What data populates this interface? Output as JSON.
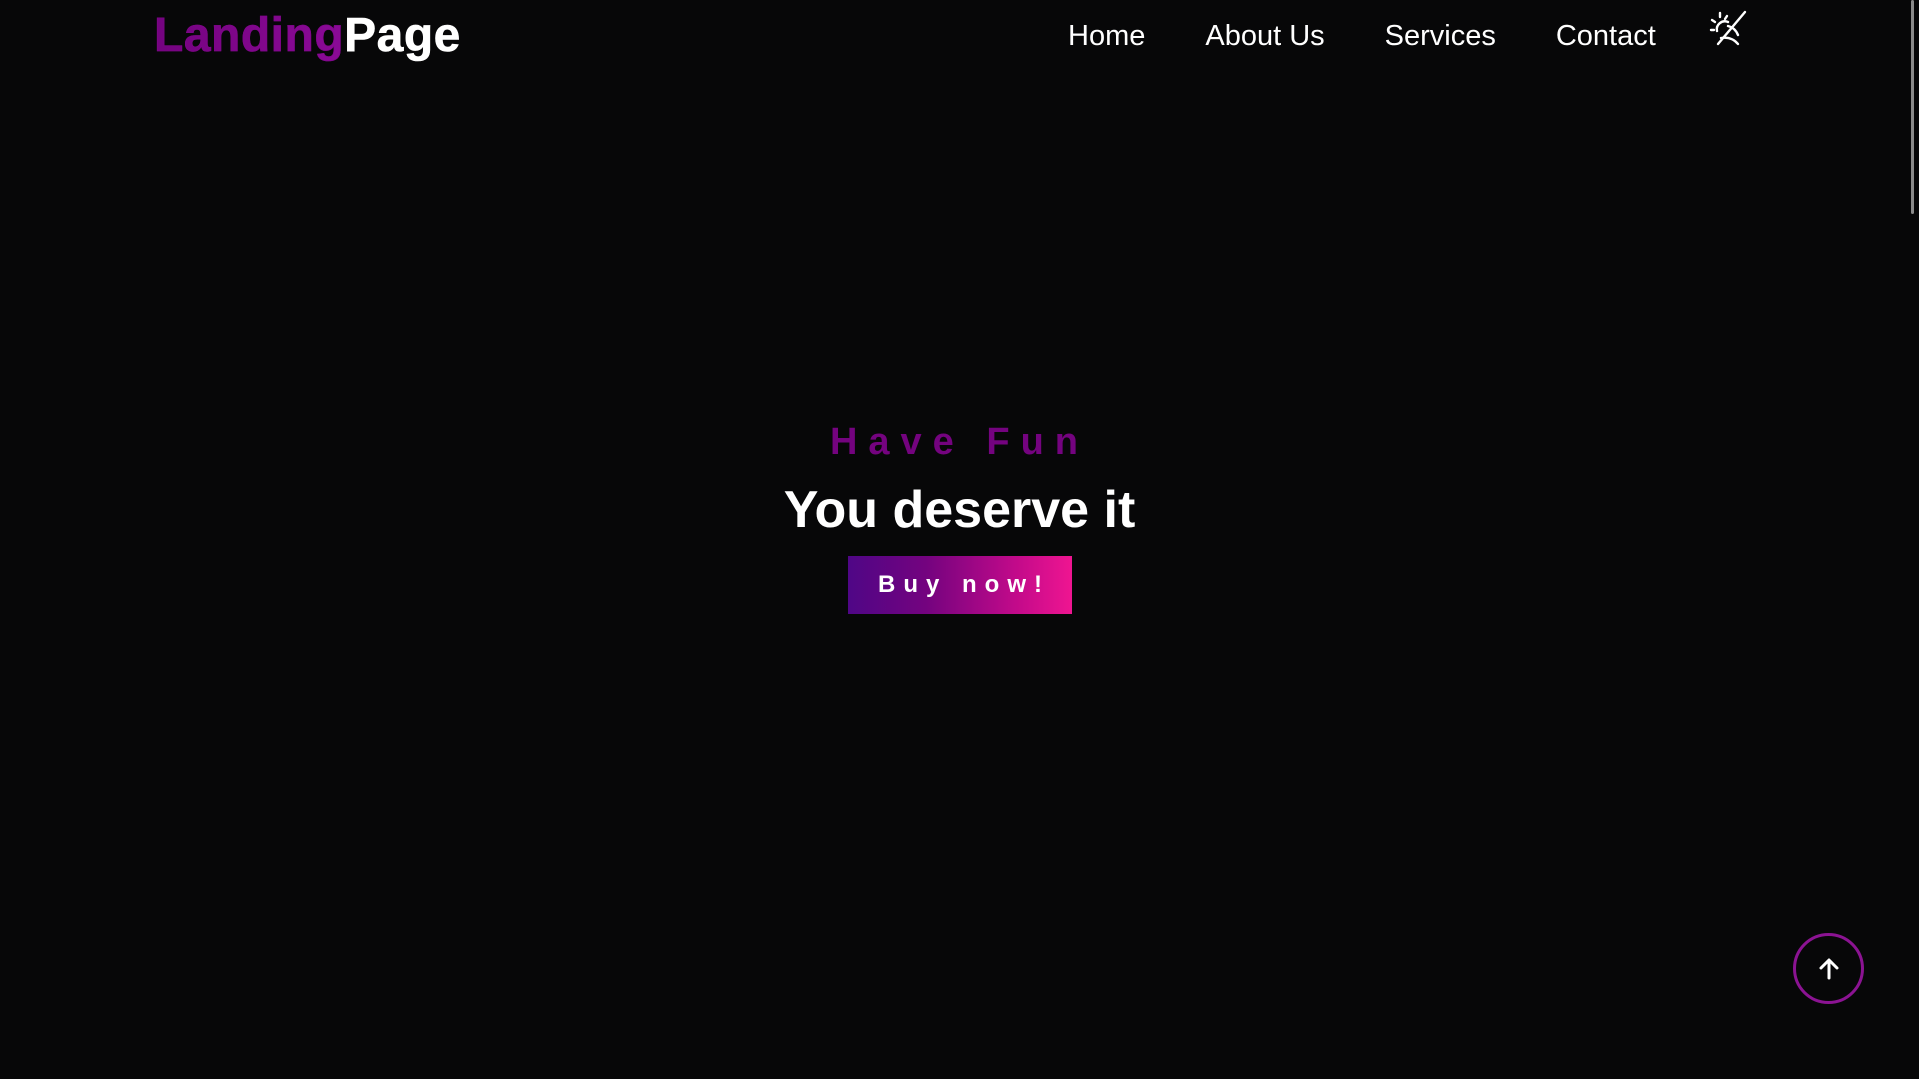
{
  "header": {
    "logo_part1": "Landing",
    "logo_part2": "Page",
    "nav": [
      {
        "label": "Home"
      },
      {
        "label": "About Us"
      },
      {
        "label": "Services"
      },
      {
        "label": "Contact"
      }
    ],
    "theme_toggle_icon": "sun-moon-icon"
  },
  "hero": {
    "kicker": "Have Fun",
    "headline": "You deserve it",
    "cta_label": "Buy now!"
  },
  "scroll_top_icon": "arrow-up-icon",
  "colors": {
    "background": "#070708",
    "accent_purple": "#74037f",
    "accent_pink": "#ef1591",
    "text": "#ffffff"
  }
}
